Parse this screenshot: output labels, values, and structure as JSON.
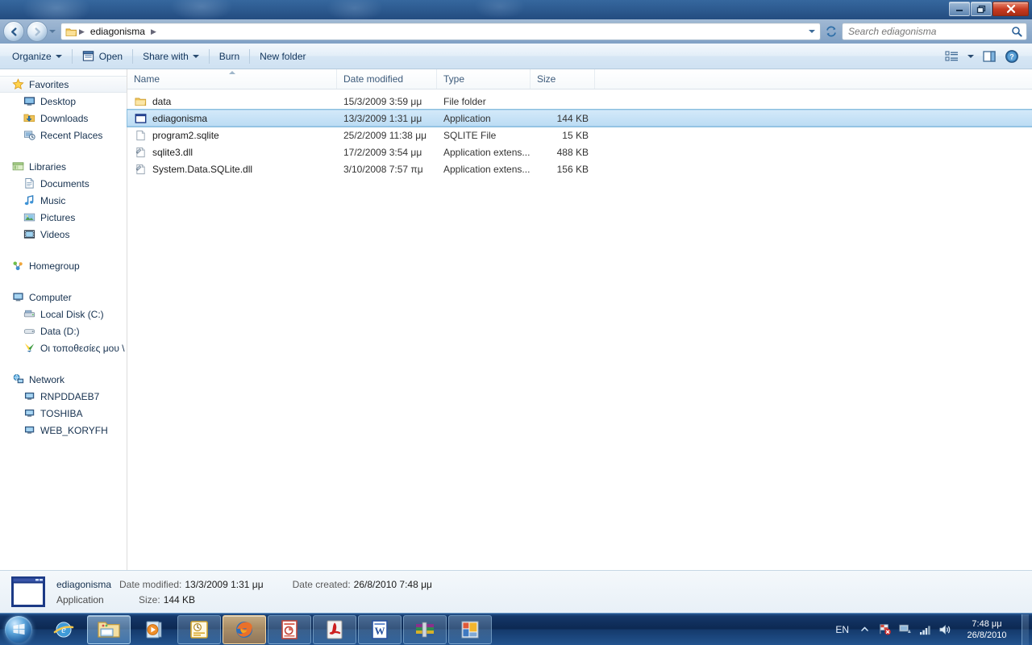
{
  "window": {
    "title": "ediagonisma",
    "controls": {
      "minimize": "Minimize",
      "restore": "Restore",
      "close": "Close"
    }
  },
  "navbar": {
    "back": "Back",
    "forward": "Forward",
    "recent_pages": "Recent pages",
    "breadcrumb": [
      "ediagonisma"
    ],
    "refresh": "Refresh",
    "search": {
      "placeholder": "Search ediagonisma",
      "value": ""
    }
  },
  "toolbar": {
    "organize": "Organize",
    "open": "Open",
    "share_with": "Share with",
    "burn": "Burn",
    "new_folder": "New folder",
    "change_view": "Change your view",
    "preview_pane": "Show the preview pane",
    "help": "Get help"
  },
  "nav_pane": {
    "groups": [
      {
        "header": "Favorites",
        "icon": "favorites-star-icon",
        "items": [
          {
            "label": "Desktop",
            "icon": "desktop-icon"
          },
          {
            "label": "Downloads",
            "icon": "downloads-icon"
          },
          {
            "label": "Recent Places",
            "icon": "recent-places-icon"
          }
        ]
      },
      {
        "header": "Libraries",
        "icon": "libraries-icon",
        "items": [
          {
            "label": "Documents",
            "icon": "documents-icon"
          },
          {
            "label": "Music",
            "icon": "music-icon"
          },
          {
            "label": "Pictures",
            "icon": "pictures-icon"
          },
          {
            "label": "Videos",
            "icon": "videos-icon"
          }
        ]
      },
      {
        "header": "Homegroup",
        "icon": "homegroup-icon",
        "items": []
      },
      {
        "header": "Computer",
        "icon": "computer-icon",
        "items": [
          {
            "label": "Local Disk (C:)",
            "icon": "local-disk-icon"
          },
          {
            "label": "Data (D:)",
            "icon": "drive-icon"
          },
          {
            "label": "Οι τοποθεσίες μου \\",
            "icon": "my-places-icon"
          }
        ]
      },
      {
        "header": "Network",
        "icon": "network-icon",
        "items": [
          {
            "label": "RNPDDAEB7",
            "icon": "computer-network-icon"
          },
          {
            "label": "TOSHIBA",
            "icon": "computer-network-icon"
          },
          {
            "label": "WEB_KORYFH",
            "icon": "computer-network-icon"
          }
        ]
      }
    ]
  },
  "file_list": {
    "columns": [
      "Name",
      "Date modified",
      "Type",
      "Size"
    ],
    "sort": {
      "column": "Name",
      "direction": "ascending"
    },
    "rows": [
      {
        "name": "data",
        "date": "15/3/2009 3:59 μμ",
        "type": "File folder",
        "size": "",
        "icon": "folder-icon",
        "selected": false
      },
      {
        "name": "ediagonisma",
        "date": "13/3/2009 1:31 μμ",
        "type": "Application",
        "size": "144 KB",
        "icon": "application-icon",
        "selected": true
      },
      {
        "name": "program2.sqlite",
        "date": "25/2/2009 11:38 μμ",
        "type": "SQLITE File",
        "size": "15 KB",
        "icon": "blank-file-icon",
        "selected": false
      },
      {
        "name": "sqlite3.dll",
        "date": "17/2/2009 3:54 μμ",
        "type": "Application extens...",
        "size": "488 KB",
        "icon": "dll-icon",
        "selected": false
      },
      {
        "name": "System.Data.SQLite.dll",
        "date": "3/10/2008 7:57 πμ",
        "type": "Application extens...",
        "size": "156 KB",
        "icon": "dll-icon",
        "selected": false
      }
    ]
  },
  "details_pane": {
    "name": "ediagonisma",
    "kind": "Application",
    "date_modified_label": "Date modified:",
    "date_modified_value": "13/3/2009 1:31 μμ",
    "size_label": "Size:",
    "size_value": "144 KB",
    "date_created_label": "Date created:",
    "date_created_value": "26/8/2010 7:48 μμ"
  },
  "taskbar": {
    "start": "Start",
    "apps": [
      {
        "name": "internet-explorer",
        "state": "pinned"
      },
      {
        "name": "windows-explorer",
        "state": "active"
      },
      {
        "name": "windows-media-player",
        "state": "pinned"
      },
      {
        "name": "outlook",
        "state": "semi"
      },
      {
        "name": "firefox",
        "state": "hot"
      },
      {
        "name": "powerpoint",
        "state": "semi"
      },
      {
        "name": "adobe-reader",
        "state": "semi"
      },
      {
        "name": "word",
        "state": "semi"
      },
      {
        "name": "winrar",
        "state": "semi"
      },
      {
        "name": "colorful-app",
        "state": "semi"
      }
    ],
    "tray": {
      "language": "EN",
      "show_hidden": "Show hidden icons",
      "action_center": "Action Center",
      "network": "Network",
      "signal": "Signal",
      "volume": "Volume",
      "clock_time": "7:48 μμ",
      "clock_date": "26/8/2010"
    }
  },
  "colors": {
    "selection": "#bcdcf4",
    "accent": "#16314f",
    "close_button": "#c83b22",
    "folder": "#f5cd6a"
  }
}
